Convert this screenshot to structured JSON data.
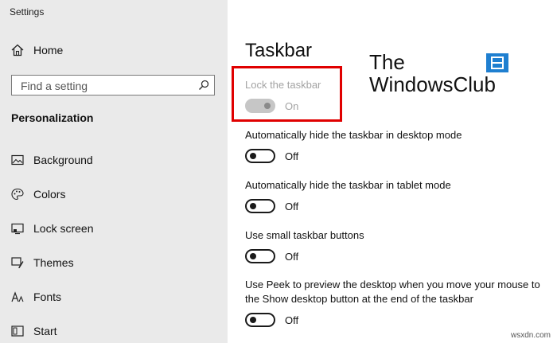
{
  "app_title": "Settings",
  "sidebar": {
    "home_label": "Home",
    "search_placeholder": "Find a setting",
    "section_title": "Personalization",
    "items": [
      {
        "label": "Background",
        "icon": "picture-icon"
      },
      {
        "label": "Colors",
        "icon": "palette-icon"
      },
      {
        "label": "Lock screen",
        "icon": "lock-screen-icon"
      },
      {
        "label": "Themes",
        "icon": "brush-icon"
      },
      {
        "label": "Fonts",
        "icon": "font-icon"
      },
      {
        "label": "Start",
        "icon": "start-icon"
      }
    ]
  },
  "main": {
    "title": "Taskbar",
    "brand": {
      "line1": "The",
      "line2": "WindowsClub"
    },
    "options": [
      {
        "label": "Lock the taskbar",
        "state": "On",
        "enabled": false
      },
      {
        "label": "Automatically hide the taskbar in desktop mode",
        "state": "Off",
        "enabled": true
      },
      {
        "label": "Automatically hide the taskbar in tablet mode",
        "state": "Off",
        "enabled": true
      },
      {
        "label": "Use small taskbar buttons",
        "state": "Off",
        "enabled": true
      },
      {
        "label_line1": "Use Peek to preview the desktop when you move your mouse to",
        "label_line2": "the Show desktop button at the end of the taskbar",
        "state": "Off",
        "enabled": true
      }
    ]
  },
  "watermark": "wsxdn.com",
  "colors": {
    "highlight": "#e00000",
    "sidebar_bg": "#eaeaea",
    "logo_blue": "#1f7fd0"
  }
}
